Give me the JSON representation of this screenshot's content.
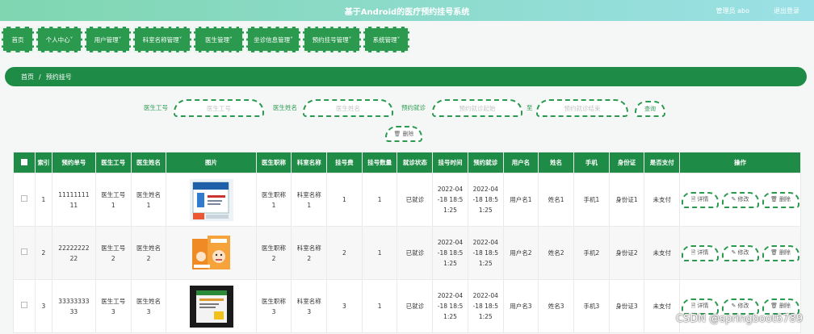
{
  "header": {
    "title": "基于Android的医疗预约挂号系统",
    "user": "管理员 abo",
    "logout": "退出登录"
  },
  "menu": [
    {
      "label": "首页"
    },
    {
      "label": "个人中心"
    },
    {
      "label": "用户管理"
    },
    {
      "label": "科室名称管理"
    },
    {
      "label": "医生管理"
    },
    {
      "label": "坐诊信息管理"
    },
    {
      "label": "预约挂号管理"
    },
    {
      "label": "系统管理"
    }
  ],
  "breadcrumb": {
    "home": "首页",
    "sep": "/",
    "current": "预约挂号"
  },
  "search": {
    "doctor_id_label": "医生工号",
    "doctor_id_placeholder": "医生工号",
    "doctor_name_label": "医生姓名",
    "doctor_name_placeholder": "医生姓名",
    "visit_label": "预约就诊",
    "visit_start_placeholder": "预约就诊起始",
    "to_label": "至",
    "visit_end_placeholder": "预约就诊结束",
    "query_button": "查询",
    "delete_button": "删除"
  },
  "table": {
    "headers": [
      "索引",
      "预约单号",
      "医生工号",
      "医生姓名",
      "图片",
      "医生职称",
      "科室名称",
      "挂号费",
      "挂号数量",
      "就诊状态",
      "挂号时间",
      "预约就诊",
      "用户名",
      "姓名",
      "手机",
      "身份证",
      "是否支付",
      "操作"
    ],
    "rows": [
      {
        "index": "1",
        "order_no_a": "11111111",
        "order_no_b": "11",
        "doctor_id_a": "医生工号",
        "doctor_id_b": "1",
        "doctor_name_a": "医生姓名",
        "doctor_name_b": "1",
        "title_a": "医生职称",
        "title_b": "1",
        "dept_a": "科室名称",
        "dept_b": "1",
        "fee": "1",
        "count": "1",
        "status": "已就诊",
        "reg_a": "2022-04",
        "reg_b": "-18 18:5",
        "reg_c": "1:25",
        "visit_a": "2022-04",
        "visit_b": "-18 18:5",
        "visit_c": "1:25",
        "username": "用户名1",
        "name": "姓名1",
        "phone": "手机1",
        "idcard": "身份证1",
        "paid": "未支付"
      },
      {
        "index": "2",
        "order_no_a": "22222222",
        "order_no_b": "22",
        "doctor_id_a": "医生工号",
        "doctor_id_b": "2",
        "doctor_name_a": "医生姓名",
        "doctor_name_b": "2",
        "title_a": "医生职称",
        "title_b": "2",
        "dept_a": "科室名称",
        "dept_b": "2",
        "fee": "2",
        "count": "1",
        "status": "已就诊",
        "reg_a": "2022-04",
        "reg_b": "-18 18:5",
        "reg_c": "1:25",
        "visit_a": "2022-04",
        "visit_b": "-18 18:5",
        "visit_c": "1:25",
        "username": "用户名2",
        "name": "姓名2",
        "phone": "手机2",
        "idcard": "身份证2",
        "paid": "未支付"
      },
      {
        "index": "3",
        "order_no_a": "33333333",
        "order_no_b": "33",
        "doctor_id_a": "医生工号",
        "doctor_id_b": "3",
        "doctor_name_a": "医生姓名",
        "doctor_name_b": "3",
        "title_a": "医生职称",
        "title_b": "3",
        "dept_a": "科室名称",
        "dept_b": "3",
        "fee": "3",
        "count": "1",
        "status": "已就诊",
        "reg_a": "2022-04",
        "reg_b": "-18 18:5",
        "reg_c": "1:25",
        "visit_a": "2022-04",
        "visit_b": "-18 18:5",
        "visit_c": "1:25",
        "username": "用户名3",
        "name": "姓名3",
        "phone": "手机3",
        "idcard": "身份证3",
        "paid": "未支付"
      }
    ],
    "actions": {
      "detail": "详情",
      "edit": "修改",
      "delete": "删除"
    }
  },
  "watermark": "CSDN @springboot6789",
  "colors": {
    "primary": "#1e8b46",
    "menu": "#2b9a4f",
    "header_start": "#7fd6b0",
    "header_end": "#9be0e6"
  },
  "icons": {
    "delete": "trash-icon",
    "detail": "doc-icon",
    "edit": "pencil-icon"
  }
}
